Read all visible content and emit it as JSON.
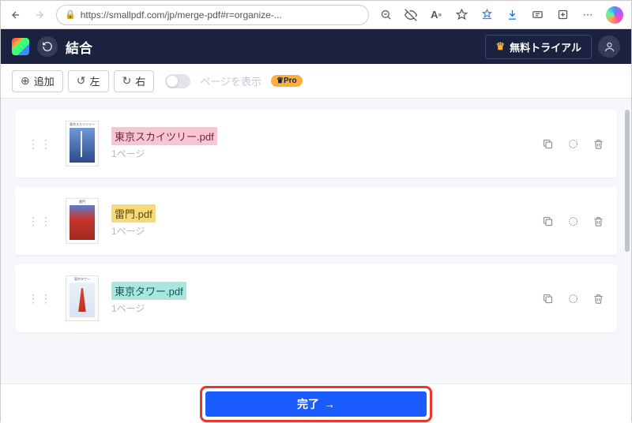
{
  "browser": {
    "url": "https://smallpdf.com/jp/merge-pdf#r=organize-..."
  },
  "header": {
    "title": "結合",
    "trial_label": "無料トライアル"
  },
  "toolbar": {
    "add": "追加",
    "left": "左",
    "right": "右",
    "toggle_label": "ページを表示",
    "pro": "Pro"
  },
  "files": [
    {
      "name": "東京スカイツリー.pdf",
      "pages": "1ページ"
    },
    {
      "name": "雷門.pdf",
      "pages": "1ページ"
    },
    {
      "name": "東京タワー.pdf",
      "pages": "1ページ"
    }
  ],
  "footer": {
    "done": "完了"
  }
}
